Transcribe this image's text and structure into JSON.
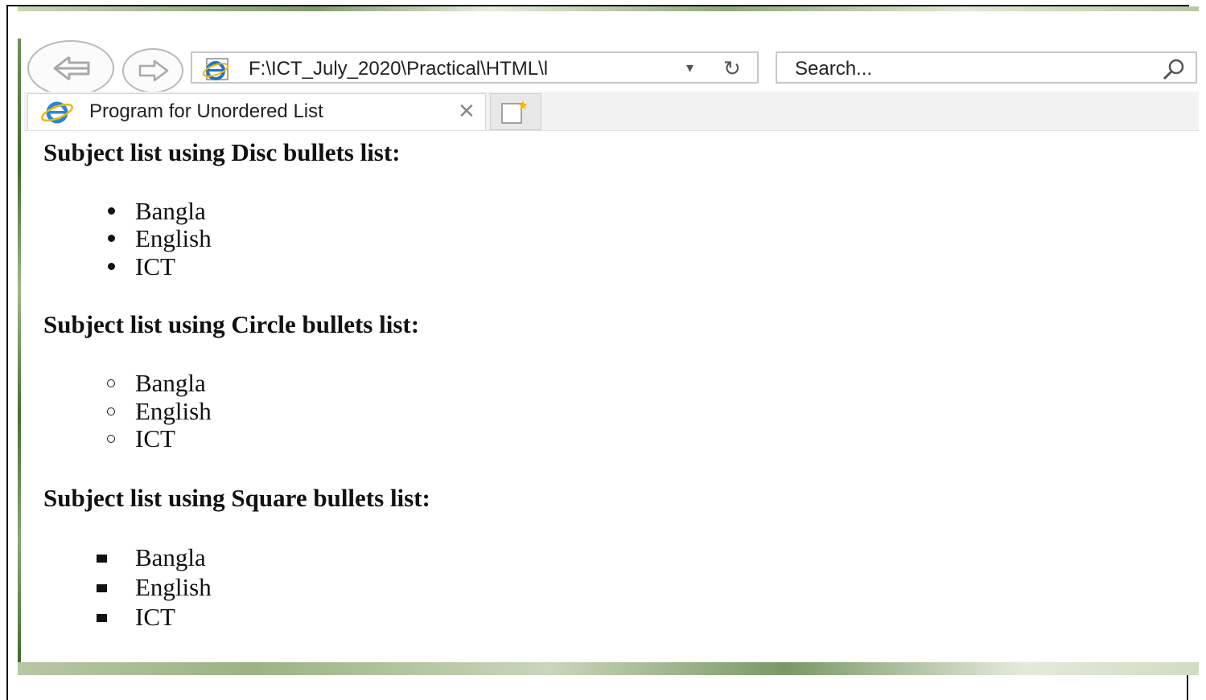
{
  "browser": {
    "address_url": "F:\\ICT_July_2020\\Practical\\HTML\\l",
    "search_placeholder": "Search...",
    "tab_title": "Program for Unordered List"
  },
  "page": {
    "sections": [
      {
        "heading": "Subject list using Disc bullets list:",
        "bullet": "disc",
        "items": [
          "Bangla",
          "English",
          "ICT"
        ]
      },
      {
        "heading": "Subject list using Circle bullets list:",
        "bullet": "circle",
        "items": [
          "Bangla",
          "English",
          "ICT"
        ]
      },
      {
        "heading": "Subject list using Square bullets list:",
        "bullet": "square",
        "items": [
          "Bangla",
          "English",
          "ICT"
        ]
      }
    ]
  },
  "icons": {
    "back": "back-arrow-icon",
    "forward": "forward-arrow-icon",
    "browser": "internet-explorer-icon",
    "dropdown": "chevron-down-icon",
    "refresh": "refresh-icon",
    "search": "search-icon",
    "close": "close-icon",
    "new_tab": "new-tab-icon"
  }
}
